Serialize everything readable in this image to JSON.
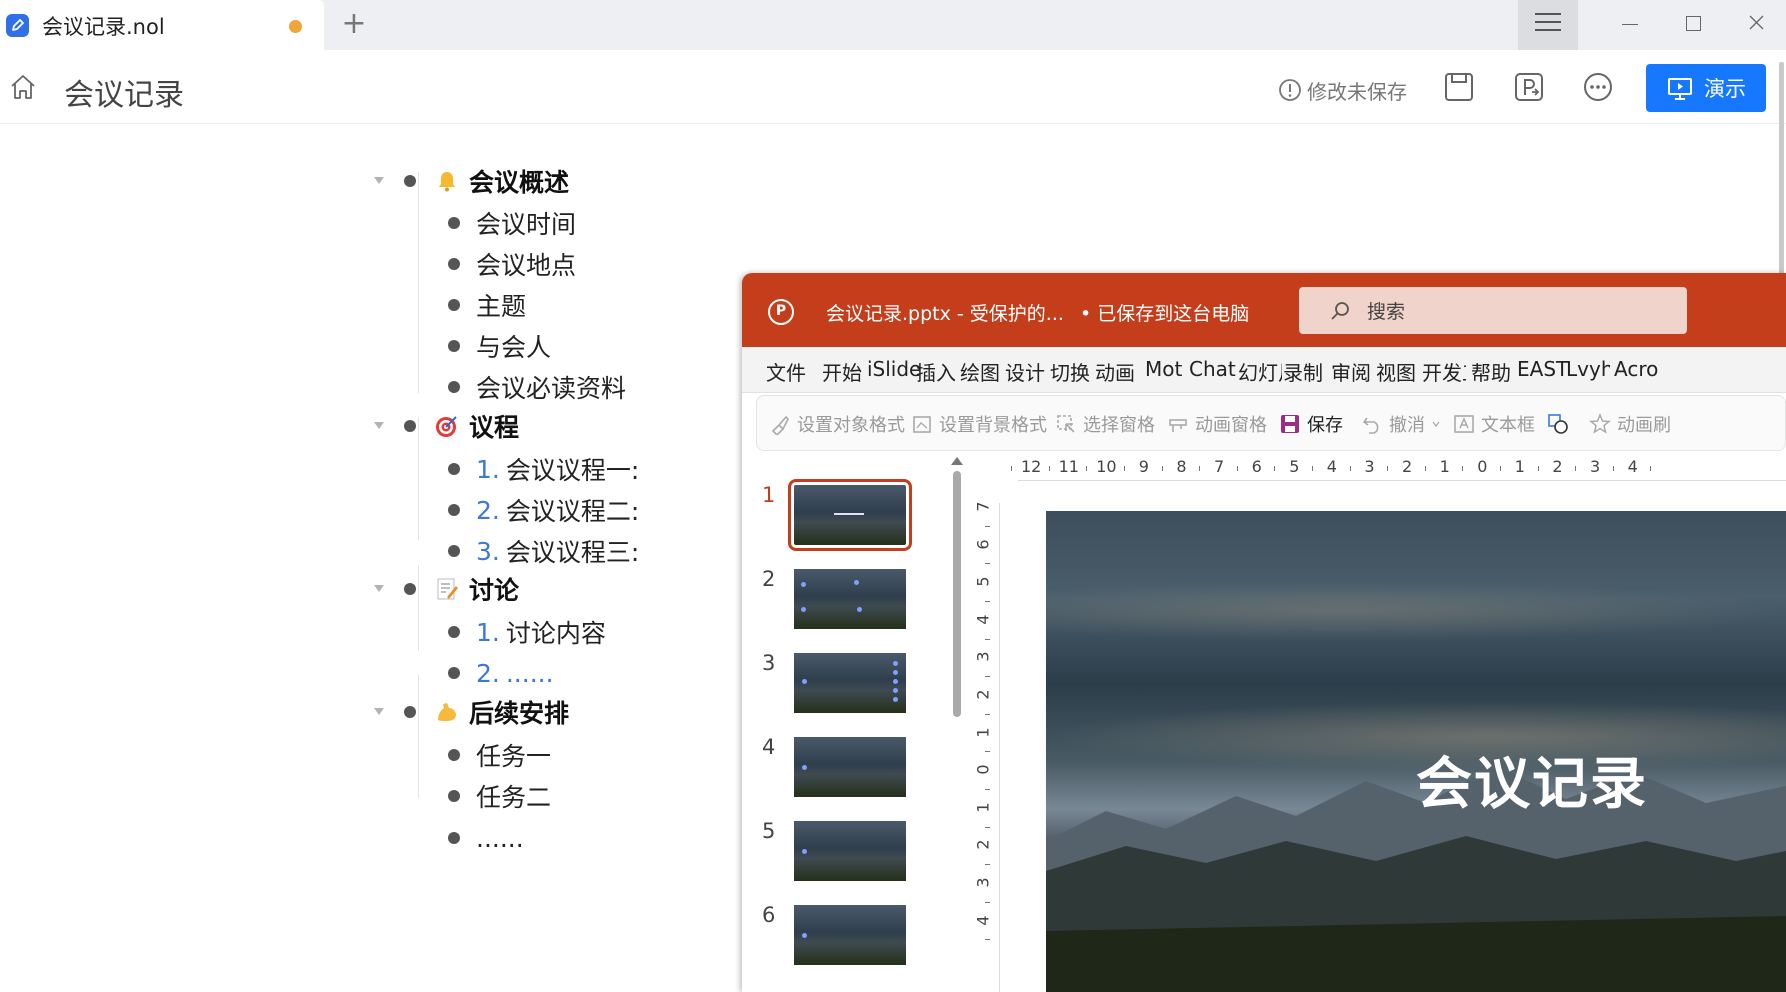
{
  "tab": {
    "title": "会议记录.nol",
    "new_tab": "+"
  },
  "header": {
    "title": "会议记录",
    "unsaved_label": "修改未保存",
    "present_label": "演示"
  },
  "outline": {
    "sections": [
      {
        "title": "会议概述",
        "icon": "bell-icon",
        "items": [
          {
            "num": "",
            "text": "会议时间"
          },
          {
            "num": "",
            "text": "会议地点"
          },
          {
            "num": "",
            "text": "主题"
          },
          {
            "num": "",
            "text": "与会人"
          },
          {
            "num": "",
            "text": "会议必读资料"
          }
        ]
      },
      {
        "title": "议程",
        "icon": "target-icon",
        "items": [
          {
            "num": "1.",
            "text": "会议议程一:"
          },
          {
            "num": "2.",
            "text": "会议议程二:"
          },
          {
            "num": "3.",
            "text": "会议议程三:"
          }
        ]
      },
      {
        "title": "讨论",
        "icon": "memo-icon",
        "items": [
          {
            "num": "1.",
            "text": "讨论内容"
          },
          {
            "num": "2.",
            "text": "......"
          }
        ]
      },
      {
        "title": "后续安排",
        "icon": "flexed-biceps-icon",
        "items": [
          {
            "num": "",
            "text": "任务一"
          },
          {
            "num": "",
            "text": "任务二"
          },
          {
            "num": "",
            "text": "......"
          }
        ]
      }
    ]
  },
  "ppt": {
    "filename": "会议记录.pptx  -  受保护的...",
    "saved_status": "•  已保存到这台电脑",
    "search_placeholder": "搜索",
    "menu": [
      "文件",
      "开始",
      "iSlide",
      "插入",
      "绘图",
      "设计",
      "切换",
      "动画",
      "Mot",
      "Chat",
      "幻灯片",
      "录制",
      "审阅",
      "视图",
      "开发工",
      "帮助",
      "EAST",
      "Lvyh",
      "Acro"
    ],
    "toolbar": {
      "format_object": "设置对象格式",
      "format_background": "设置背景格式",
      "selection_pane": "选择窗格",
      "animation_pane": "动画窗格",
      "save": "保存",
      "undo": "撤消",
      "textbox": "文本框",
      "animation_painter": "动画刷"
    },
    "slides": [
      "1",
      "2",
      "3",
      "4",
      "5",
      "6"
    ],
    "hruler_labels": [
      "12",
      "11",
      "10",
      "9",
      "8",
      "7",
      "6",
      "5",
      "4",
      "3",
      "2",
      "1",
      "0",
      "1",
      "2",
      "3",
      "4"
    ],
    "vruler_labels": [
      "7",
      "6",
      "5",
      "4",
      "3",
      "2",
      "1",
      "0",
      "1",
      "2",
      "3",
      "4"
    ],
    "slide_title": "会议记录"
  },
  "colors": {
    "accent_blue": "#1677ff",
    "ppt_red": "#c43e1c",
    "unsaved_dot": "#f0a43a",
    "number_blue": "#3c78d8"
  }
}
